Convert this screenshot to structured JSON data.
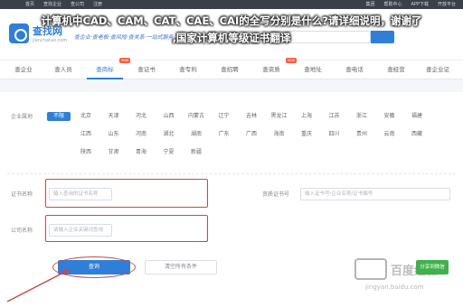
{
  "overlay": {
    "title_line1": "计算机中CAD、CAM、CAT、CAE、CAI的全写分别是什么?请详细说明，谢谢了",
    "title_line2": ",国家计算机等级证书翻译"
  },
  "topbar": {
    "left": [
      "首页",
      "查找企业",
      "查公司",
      "注册"
    ],
    "right": [
      "集团",
      "帮助中心",
      "APP下载",
      "开放平台"
    ]
  },
  "header": {
    "logo_name": "查找网",
    "logo_domain": "jianchatao.com",
    "slogan": "查企业·查老板·查风险·查关系·一站式服务"
  },
  "nav": {
    "items": [
      {
        "label": "查企业"
      },
      {
        "label": "查人员"
      },
      {
        "label": "查商标",
        "active": true,
        "badge": "new"
      },
      {
        "label": "查证书"
      },
      {
        "label": "查专利"
      },
      {
        "label": "查招聘"
      },
      {
        "label": "查资质",
        "badge": "new"
      },
      {
        "label": "查地址"
      },
      {
        "label": "查电话"
      },
      {
        "label": "查经营"
      },
      {
        "label": "查企业证"
      }
    ]
  },
  "filter": {
    "label": "企业属地",
    "regions_row1": [
      "不限",
      "北京",
      "天津",
      "河北",
      "山西",
      "内蒙古",
      "辽宁",
      "吉林",
      "黑龙江",
      "上海",
      "江苏",
      "浙江",
      "安徽",
      "福建"
    ],
    "regions_row2": [
      "江西",
      "山东",
      "河南",
      "湖北",
      "湖南",
      "广东",
      "广西",
      "海南",
      "重庆",
      "四川",
      "贵州",
      "云南",
      "西藏"
    ],
    "regions_row3": [
      "陕西",
      "甘肃",
      "青海",
      "宁夏",
      "新疆"
    ]
  },
  "form": {
    "field1_label": "证书名称",
    "field1_placeholder": "输入查询的证书名称",
    "field2_label": "资质证书号",
    "field2_placeholder": "输入证书号/企业名称/证书编号",
    "field3_label": "公司名称",
    "field3_placeholder": "请输入企业关键词查询"
  },
  "buttons": {
    "query": "查询",
    "clear": "清空所有条件"
  },
  "watermark": {
    "text": "百度经验",
    "url": "jingyan.baidu.com"
  },
  "side_badge": "分享到微信",
  "colors": {
    "accent": "#2f7fd8",
    "annotation_red": "#c74a4a",
    "overlay_text": "#ffffff"
  }
}
